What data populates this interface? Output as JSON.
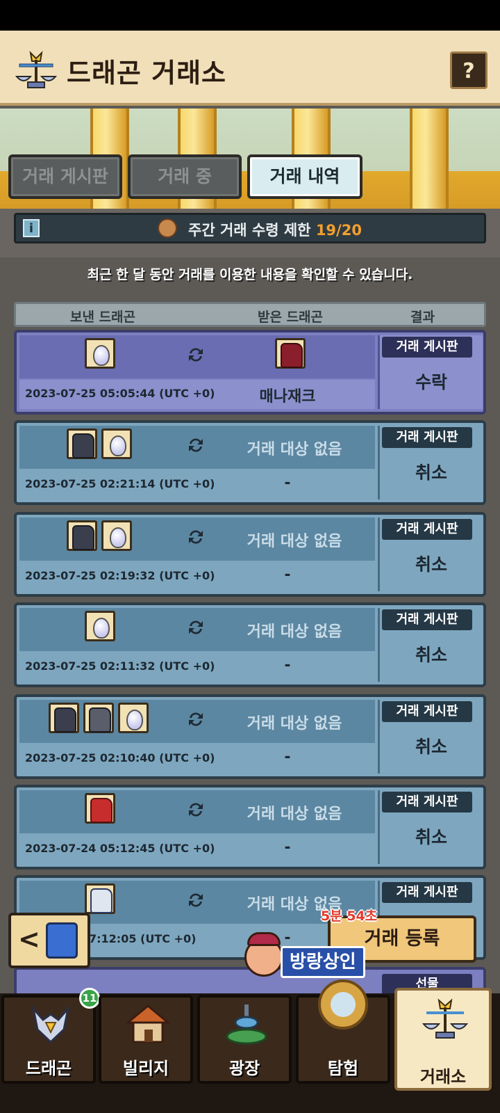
{
  "header": {
    "title": "드래곤 거래소",
    "help_label": "?"
  },
  "tabs": [
    {
      "label": "거래 게시판",
      "active": false
    },
    {
      "label": "거래 중",
      "active": false
    },
    {
      "label": "거래 내역",
      "active": true
    }
  ],
  "limit": {
    "info_label": "i",
    "text": "주간 거래 수령 제한",
    "count": "19/20"
  },
  "notice": "최근 한 달 동안 거래를 이용한 내용을 확인할 수 있습니다.",
  "columns": {
    "sent": "보낸 드래곤",
    "received": "받은 드래곤",
    "result": "결과"
  },
  "rows": [
    {
      "board": "거래 게시판",
      "result": "수락",
      "date": "2023-07-25 05:05:44 (UTC +0)",
      "target": "",
      "recv_name": "매나재크"
    },
    {
      "board": "거래 게시판",
      "result": "취소",
      "date": "2023-07-25 02:21:14 (UTC +0)",
      "target": "거래 대상 없음",
      "recv_name": "-"
    },
    {
      "board": "거래 게시판",
      "result": "취소",
      "date": "2023-07-25 02:19:32 (UTC +0)",
      "target": "거래 대상 없음",
      "recv_name": "-"
    },
    {
      "board": "거래 게시판",
      "result": "취소",
      "date": "2023-07-25 02:11:32 (UTC +0)",
      "target": "거래 대상 없음",
      "recv_name": "-"
    },
    {
      "board": "거래 게시판",
      "result": "취소",
      "date": "2023-07-25 02:10:40 (UTC +0)",
      "target": "거래 대상 없음",
      "recv_name": "-"
    },
    {
      "board": "거래 게시판",
      "result": "취소",
      "date": "2023-07-24 05:12:45 (UTC +0)",
      "target": "거래 대상 없음",
      "recv_name": "-"
    },
    {
      "board": "거래 게시판",
      "result": "",
      "date": "7:12:05 (UTC +0)",
      "target": "거래 대상 없음",
      "recv_name": "-"
    }
  ],
  "partial_row": {
    "board": "선물"
  },
  "register": {
    "label": "거래 등록",
    "timer": "5분 54초"
  },
  "merchant": {
    "label": "방랑상인"
  },
  "back": {
    "label": "<"
  },
  "nav": [
    {
      "label": "드래곤",
      "badge": "11"
    },
    {
      "label": "빌리지"
    },
    {
      "label": "광장"
    },
    {
      "label": "탐험"
    },
    {
      "label": "거래소"
    }
  ],
  "colors": {
    "accent": "#f3a02f",
    "accepted_row": "#7c80c1",
    "cancel_row": "#7ea6bf"
  }
}
